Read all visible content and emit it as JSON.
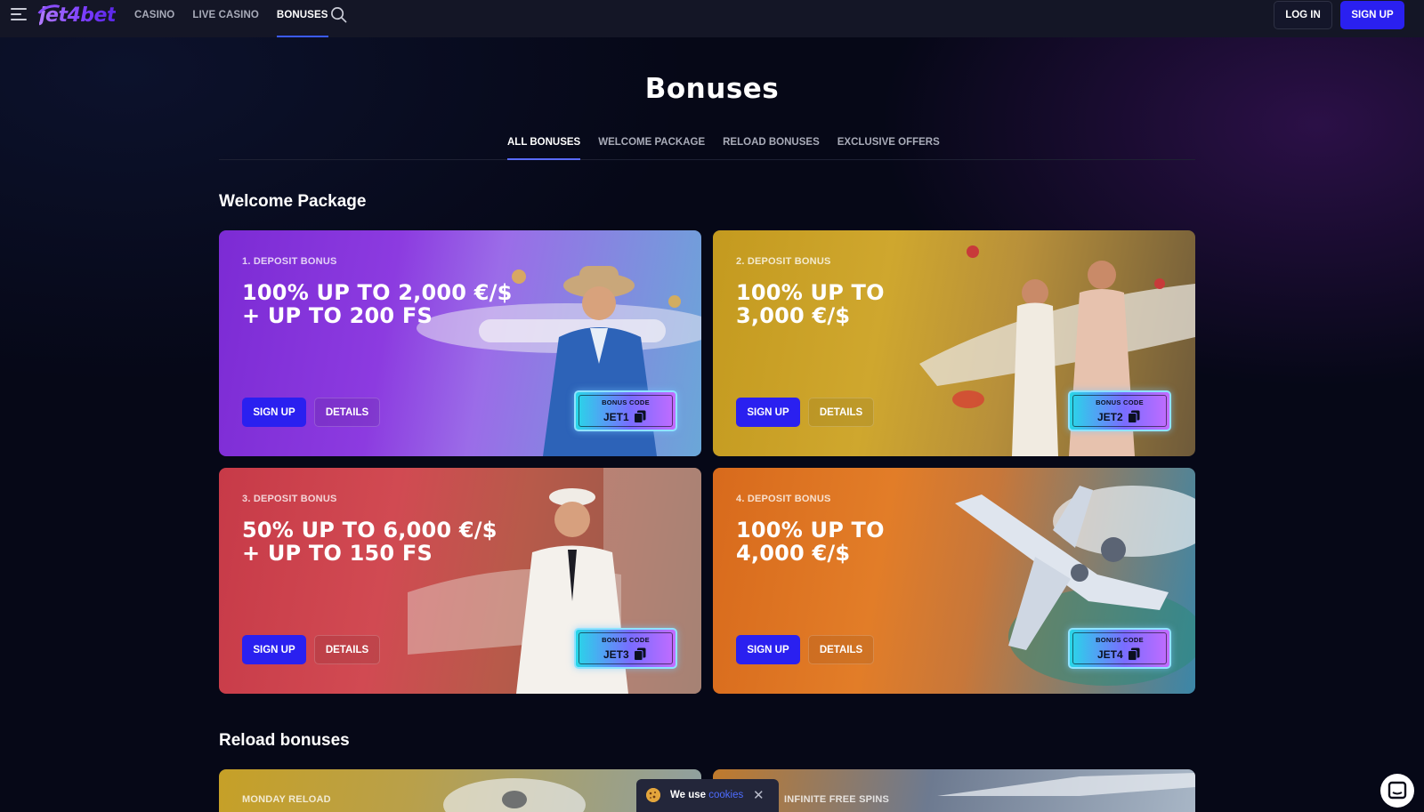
{
  "header": {
    "logo": "jet4bet",
    "nav": [
      {
        "label": "CASINO"
      },
      {
        "label": "LIVE CASINO"
      },
      {
        "label": "BONUSES"
      }
    ],
    "login_label": "LOG IN",
    "signup_label": "SIGN UP"
  },
  "page": {
    "title": "Bonuses",
    "tabs": [
      {
        "label": "ALL BONUSES"
      },
      {
        "label": "WELCOME PACKAGE"
      },
      {
        "label": "RELOAD BONUSES"
      },
      {
        "label": "EXCLUSIVE OFFERS"
      }
    ]
  },
  "welcome": {
    "title": "Welcome Package",
    "cards": [
      {
        "kicker": "1. DEPOSIT BONUS",
        "headline_1": "100% UP TO 2,000 €/$",
        "headline_2": "+ UP TO 200 FS",
        "cta": "SIGN UP",
        "details": "DETAILS",
        "code_label": "BONUS CODE",
        "code": "JET1",
        "accent": "#7c2bd4"
      },
      {
        "kicker": "2. DEPOSIT BONUS",
        "headline_1": "100% UP TO",
        "headline_2": "3,000 €/$",
        "cta": "SIGN UP",
        "details": "DETAILS",
        "code_label": "BONUS CODE",
        "code": "JET2",
        "accent": "#c49a1f"
      },
      {
        "kicker": "3. DEPOSIT BONUS",
        "headline_1": "50% UP TO 6,000 €/$",
        "headline_2": "+ UP TO 150 FS",
        "cta": "SIGN UP",
        "details": "DETAILS",
        "code_label": "BONUS CODE",
        "code": "JET3",
        "accent": "#c73a48"
      },
      {
        "kicker": "4. DEPOSIT BONUS",
        "headline_1": "100% UP TO",
        "headline_2": "4,000 €/$",
        "cta": "SIGN UP",
        "details": "DETAILS",
        "code_label": "BONUS CODE",
        "code": "JET4",
        "accent": "#d86a1c"
      }
    ]
  },
  "reload": {
    "title": "Reload bonuses",
    "cards": [
      {
        "kicker": "MONDAY RELOAD"
      },
      {
        "kicker": "INFINITE FREE SPINS"
      }
    ]
  },
  "cookie": {
    "text": "We use",
    "link": "cookies",
    "close": "✕"
  },
  "icons": {
    "menu": "menu-icon",
    "search": "search-icon",
    "copy": "copy-icon",
    "cookie": "cookie-icon",
    "chat": "chat-icon"
  },
  "colors": {
    "background": "#060817",
    "header": "#141626",
    "primary_button": "#2a20f0",
    "active_tab_underline": "#5a6bff",
    "link": "#4e6cff"
  }
}
